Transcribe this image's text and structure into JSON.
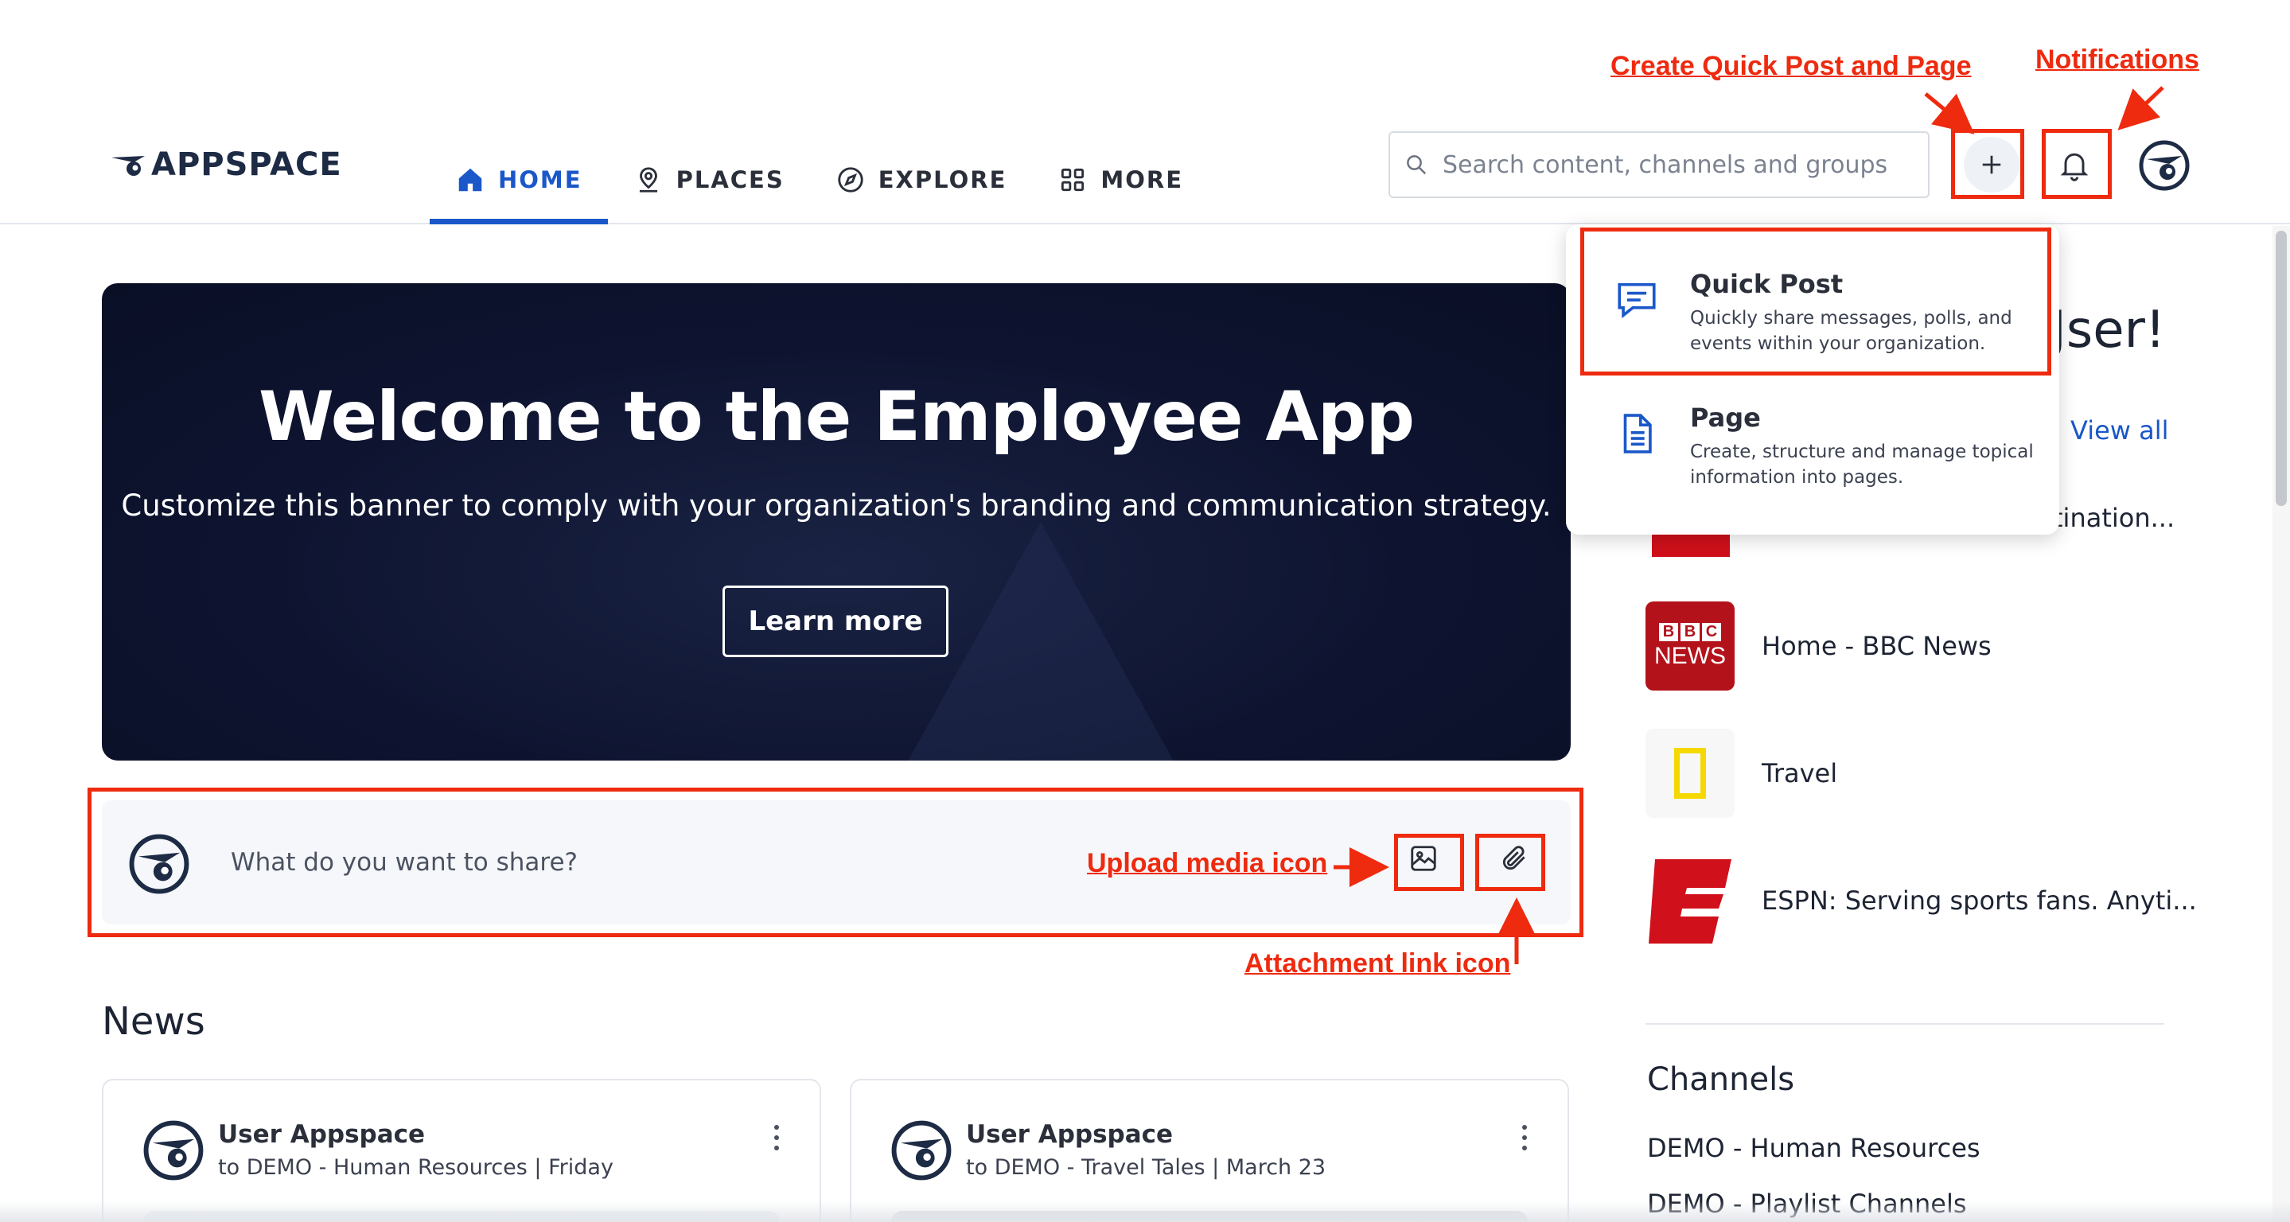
{
  "brand": {
    "name": "APPSPACE"
  },
  "nav": {
    "items": [
      {
        "label": "HOME",
        "icon": "home-icon",
        "active": true
      },
      {
        "label": "PLACES",
        "icon": "location-pin-icon",
        "active": false
      },
      {
        "label": "EXPLORE",
        "icon": "compass-icon",
        "active": false
      },
      {
        "label": "MORE",
        "icon": "grid-icon",
        "active": false
      }
    ]
  },
  "search": {
    "placeholder": "Search content, channels and groups"
  },
  "annotations": {
    "create": "Create Quick Post and Page",
    "notifications": "Notifications",
    "upload_media": "Upload media icon",
    "attachment": "Attachment link icon"
  },
  "banner": {
    "title": "Welcome to the Employee App",
    "subtitle": "Customize this banner to comply with your organization's branding and communication strategy.",
    "button": "Learn more"
  },
  "composer": {
    "placeholder": "What do you want to share?"
  },
  "news": {
    "heading": "News",
    "cards": [
      {
        "author": "User Appspace",
        "meta": "to DEMO - Human Resources | Friday"
      },
      {
        "author": "User Appspace",
        "meta": "to DEMO - Travel Tales | March 23"
      }
    ]
  },
  "dropdown": {
    "items": [
      {
        "title": "Quick Post",
        "description": "Quickly share messages, polls, and events within your organization."
      },
      {
        "title": "Page",
        "description": "Create, structure and manage topical information into pages."
      }
    ]
  },
  "sidebar": {
    "greeting_fragment": "Jser!",
    "view_all": "View all",
    "truncated_item": "tination...",
    "feeds": [
      {
        "label": "Home - BBC News",
        "thumb_line1": "BBC",
        "thumb_line2": "NEWS"
      },
      {
        "label": "Travel"
      },
      {
        "label": "ESPN: Serving sports fans. Anyti..."
      }
    ],
    "channels_heading": "Channels",
    "channels": [
      "DEMO - Human Resources",
      "DEMO - Playlist Channels"
    ]
  },
  "colors": {
    "accent": "#1a57c9",
    "annotation": "#ee2a0f",
    "banner_bg": "#0e1430",
    "bbc_red": "#b3121b",
    "natgeo_yellow": "#f5d800",
    "espn_red": "#d0101a"
  }
}
